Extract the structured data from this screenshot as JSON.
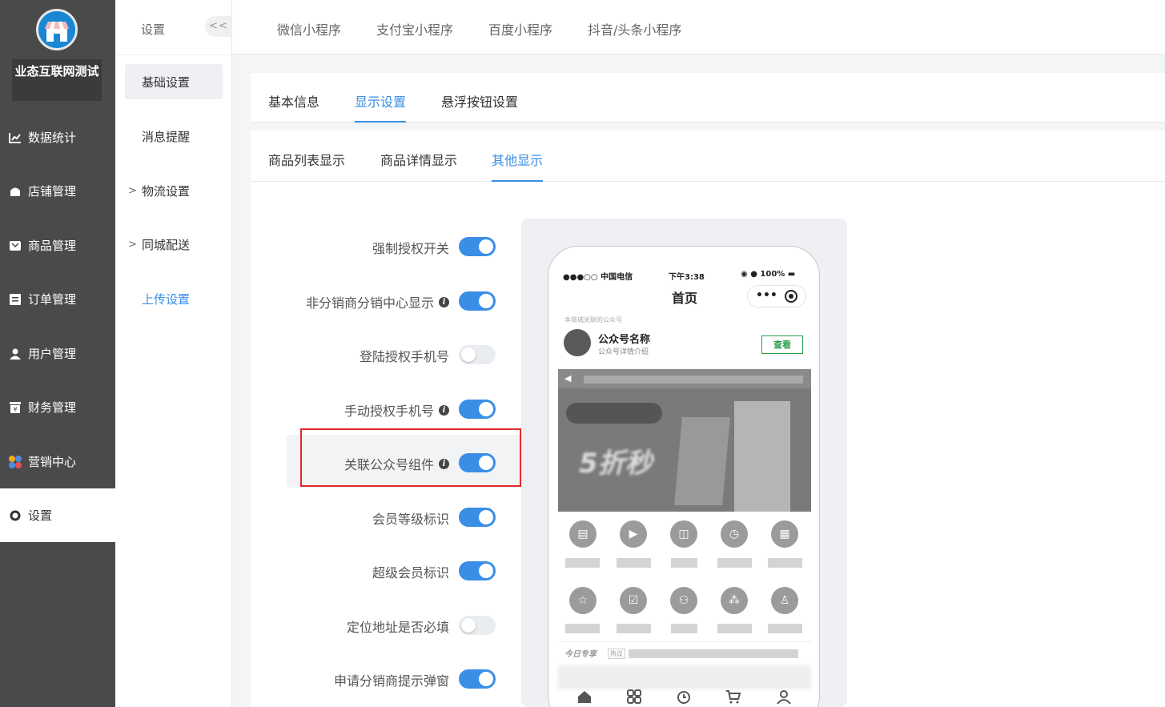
{
  "sidebar": {
    "store_name": "业态互联网测试",
    "items": [
      {
        "label": "数据统计",
        "icon": "chart-line-icon"
      },
      {
        "label": "店铺管理",
        "icon": "store-icon"
      },
      {
        "label": "商品管理",
        "icon": "goods-icon"
      },
      {
        "label": "订单管理",
        "icon": "order-icon"
      },
      {
        "label": "用户管理",
        "icon": "user-icon"
      },
      {
        "label": "财务管理",
        "icon": "finance-icon"
      },
      {
        "label": "营销中心",
        "icon": "marketing-icon"
      },
      {
        "label": "设置",
        "icon": "settings-icon"
      }
    ]
  },
  "submenu": {
    "title": "设置",
    "collapse": "<<",
    "items": [
      {
        "label": "基础设置"
      },
      {
        "label": "消息提醒"
      },
      {
        "label": "物流设置",
        "arrow": ">"
      },
      {
        "label": "同城配送",
        "arrow": ">"
      },
      {
        "label": "上传设置"
      }
    ]
  },
  "topbar": {
    "tabs": [
      "微信小程序",
      "支付宝小程序",
      "百度小程序",
      "抖音/头条小程序"
    ]
  },
  "main_tabs": [
    "基本信息",
    "显示设置",
    "悬浮按钮设置"
  ],
  "sub_tabs": [
    "商品列表显示",
    "商品详情显示",
    "其他显示"
  ],
  "settings": [
    {
      "label": "强制授权开关",
      "info": false,
      "on": true
    },
    {
      "label": "非分销商分销中心显示",
      "info": true,
      "on": true
    },
    {
      "label": "登陆授权手机号",
      "info": false,
      "on": false
    },
    {
      "label": "手动授权手机号",
      "info": true,
      "on": true
    },
    {
      "label": "关联公众号组件",
      "info": true,
      "on": true
    },
    {
      "label": "会员等级标识",
      "info": false,
      "on": true
    },
    {
      "label": "超级会员标识",
      "info": false,
      "on": true
    },
    {
      "label": "定位地址是否必填",
      "info": false,
      "on": false
    },
    {
      "label": "申请分销商提示弹窗",
      "info": false,
      "on": true
    }
  ],
  "phone": {
    "carrier": "●●●○○ 中国电信",
    "time": "下午3:38",
    "battery": "100%",
    "title": "首页",
    "mp_label": "本商城关联的公众号",
    "mp_name": "公众号名称",
    "mp_desc": "公众号详情介绍",
    "mp_button": "查看",
    "banner_text": "5折秒",
    "feed_label": "今日专享",
    "feed_tag": "热议"
  },
  "colors": {
    "accent": "#3a8ee6",
    "sidebar_bg": "#4a4a4a",
    "highlight": "#e02a2a"
  }
}
